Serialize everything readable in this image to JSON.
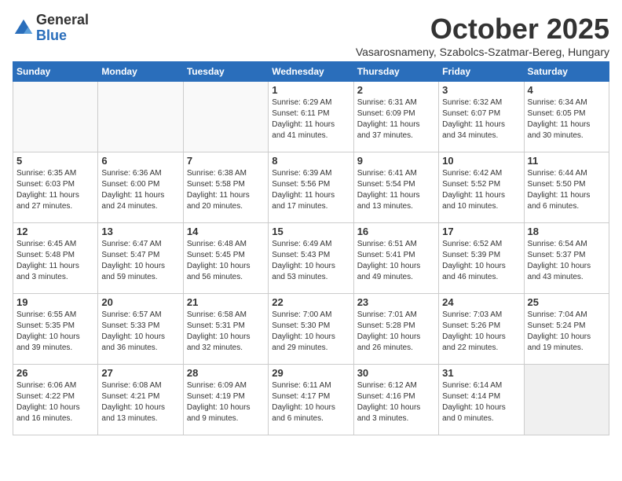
{
  "logo": {
    "general": "General",
    "blue": "Blue"
  },
  "title": "October 2025",
  "subtitle": "Vasarosnameny, Szabolcs-Szatmar-Bereg, Hungary",
  "days_of_week": [
    "Sunday",
    "Monday",
    "Tuesday",
    "Wednesday",
    "Thursday",
    "Friday",
    "Saturday"
  ],
  "weeks": [
    [
      {
        "day": "",
        "content": ""
      },
      {
        "day": "",
        "content": ""
      },
      {
        "day": "",
        "content": ""
      },
      {
        "day": "1",
        "content": "Sunrise: 6:29 AM\nSunset: 6:11 PM\nDaylight: 11 hours\nand 41 minutes."
      },
      {
        "day": "2",
        "content": "Sunrise: 6:31 AM\nSunset: 6:09 PM\nDaylight: 11 hours\nand 37 minutes."
      },
      {
        "day": "3",
        "content": "Sunrise: 6:32 AM\nSunset: 6:07 PM\nDaylight: 11 hours\nand 34 minutes."
      },
      {
        "day": "4",
        "content": "Sunrise: 6:34 AM\nSunset: 6:05 PM\nDaylight: 11 hours\nand 30 minutes."
      }
    ],
    [
      {
        "day": "5",
        "content": "Sunrise: 6:35 AM\nSunset: 6:03 PM\nDaylight: 11 hours\nand 27 minutes."
      },
      {
        "day": "6",
        "content": "Sunrise: 6:36 AM\nSunset: 6:00 PM\nDaylight: 11 hours\nand 24 minutes."
      },
      {
        "day": "7",
        "content": "Sunrise: 6:38 AM\nSunset: 5:58 PM\nDaylight: 11 hours\nand 20 minutes."
      },
      {
        "day": "8",
        "content": "Sunrise: 6:39 AM\nSunset: 5:56 PM\nDaylight: 11 hours\nand 17 minutes."
      },
      {
        "day": "9",
        "content": "Sunrise: 6:41 AM\nSunset: 5:54 PM\nDaylight: 11 hours\nand 13 minutes."
      },
      {
        "day": "10",
        "content": "Sunrise: 6:42 AM\nSunset: 5:52 PM\nDaylight: 11 hours\nand 10 minutes."
      },
      {
        "day": "11",
        "content": "Sunrise: 6:44 AM\nSunset: 5:50 PM\nDaylight: 11 hours\nand 6 minutes."
      }
    ],
    [
      {
        "day": "12",
        "content": "Sunrise: 6:45 AM\nSunset: 5:48 PM\nDaylight: 11 hours\nand 3 minutes."
      },
      {
        "day": "13",
        "content": "Sunrise: 6:47 AM\nSunset: 5:47 PM\nDaylight: 10 hours\nand 59 minutes."
      },
      {
        "day": "14",
        "content": "Sunrise: 6:48 AM\nSunset: 5:45 PM\nDaylight: 10 hours\nand 56 minutes."
      },
      {
        "day": "15",
        "content": "Sunrise: 6:49 AM\nSunset: 5:43 PM\nDaylight: 10 hours\nand 53 minutes."
      },
      {
        "day": "16",
        "content": "Sunrise: 6:51 AM\nSunset: 5:41 PM\nDaylight: 10 hours\nand 49 minutes."
      },
      {
        "day": "17",
        "content": "Sunrise: 6:52 AM\nSunset: 5:39 PM\nDaylight: 10 hours\nand 46 minutes."
      },
      {
        "day": "18",
        "content": "Sunrise: 6:54 AM\nSunset: 5:37 PM\nDaylight: 10 hours\nand 43 minutes."
      }
    ],
    [
      {
        "day": "19",
        "content": "Sunrise: 6:55 AM\nSunset: 5:35 PM\nDaylight: 10 hours\nand 39 minutes."
      },
      {
        "day": "20",
        "content": "Sunrise: 6:57 AM\nSunset: 5:33 PM\nDaylight: 10 hours\nand 36 minutes."
      },
      {
        "day": "21",
        "content": "Sunrise: 6:58 AM\nSunset: 5:31 PM\nDaylight: 10 hours\nand 32 minutes."
      },
      {
        "day": "22",
        "content": "Sunrise: 7:00 AM\nSunset: 5:30 PM\nDaylight: 10 hours\nand 29 minutes."
      },
      {
        "day": "23",
        "content": "Sunrise: 7:01 AM\nSunset: 5:28 PM\nDaylight: 10 hours\nand 26 minutes."
      },
      {
        "day": "24",
        "content": "Sunrise: 7:03 AM\nSunset: 5:26 PM\nDaylight: 10 hours\nand 22 minutes."
      },
      {
        "day": "25",
        "content": "Sunrise: 7:04 AM\nSunset: 5:24 PM\nDaylight: 10 hours\nand 19 minutes."
      }
    ],
    [
      {
        "day": "26",
        "content": "Sunrise: 6:06 AM\nSunset: 4:22 PM\nDaylight: 10 hours\nand 16 minutes."
      },
      {
        "day": "27",
        "content": "Sunrise: 6:08 AM\nSunset: 4:21 PM\nDaylight: 10 hours\nand 13 minutes."
      },
      {
        "day": "28",
        "content": "Sunrise: 6:09 AM\nSunset: 4:19 PM\nDaylight: 10 hours\nand 9 minutes."
      },
      {
        "day": "29",
        "content": "Sunrise: 6:11 AM\nSunset: 4:17 PM\nDaylight: 10 hours\nand 6 minutes."
      },
      {
        "day": "30",
        "content": "Sunrise: 6:12 AM\nSunset: 4:16 PM\nDaylight: 10 hours\nand 3 minutes."
      },
      {
        "day": "31",
        "content": "Sunrise: 6:14 AM\nSunset: 4:14 PM\nDaylight: 10 hours\nand 0 minutes."
      },
      {
        "day": "",
        "content": ""
      }
    ]
  ]
}
